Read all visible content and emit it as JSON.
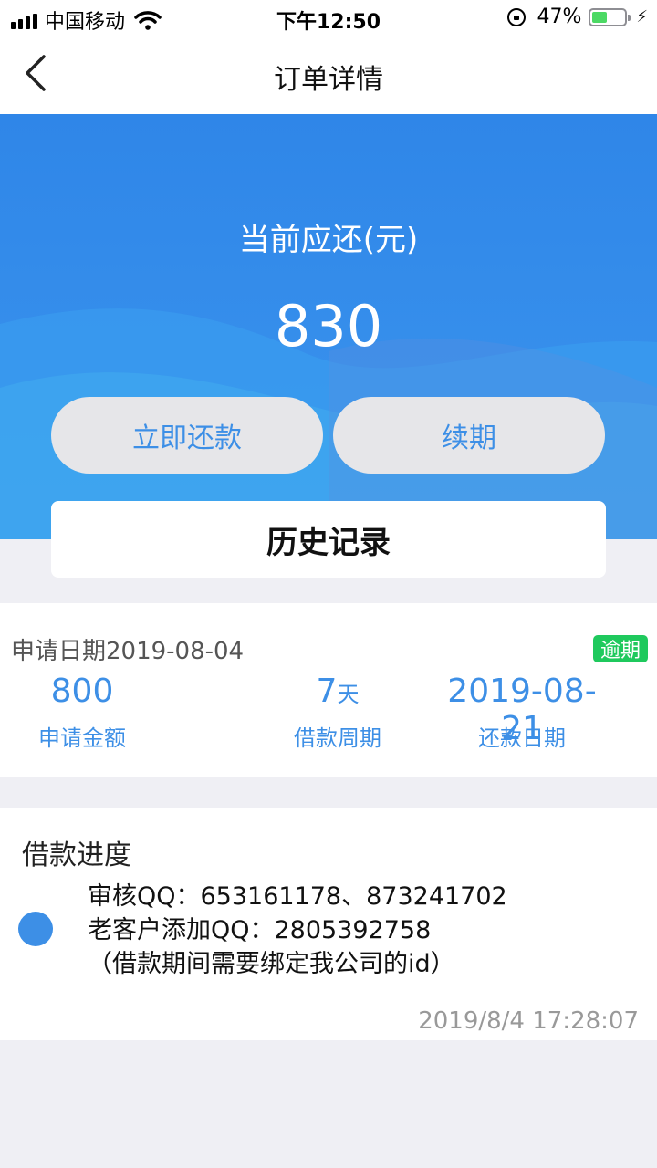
{
  "status_bar": {
    "carrier": "中国移动",
    "time": "下午12:50",
    "battery_percent": "47%",
    "battery_level": 0.47
  },
  "nav": {
    "title": "订单详情",
    "back_icon": "chevron-left-icon"
  },
  "hero": {
    "label": "当前应还(元)",
    "amount": "830",
    "repay_button": "立即还款",
    "renew_button": "续期",
    "history_button": "历史记录"
  },
  "order": {
    "apply_date": "申请日期2019-08-04",
    "status_badge": "逾期",
    "amount_value": "800",
    "amount_label": "申请金额",
    "period_value": "7",
    "period_unit": "天",
    "period_label": "借款周期",
    "due_value": "2019-08-21",
    "due_label": "还款日期"
  },
  "progress": {
    "title": "借款进度",
    "line1": "审核QQ：653161178、873241702",
    "line2": "老客户添加QQ：2805392758",
    "line3": "（借款期间需要绑定我公司的id）",
    "time": "2019/8/4 17:28:07"
  },
  "colors": {
    "accent": "#3d8fe6",
    "hero_bg": "#2f86e8",
    "badge": "#1fc95d",
    "page_bg": "#efeff4"
  }
}
